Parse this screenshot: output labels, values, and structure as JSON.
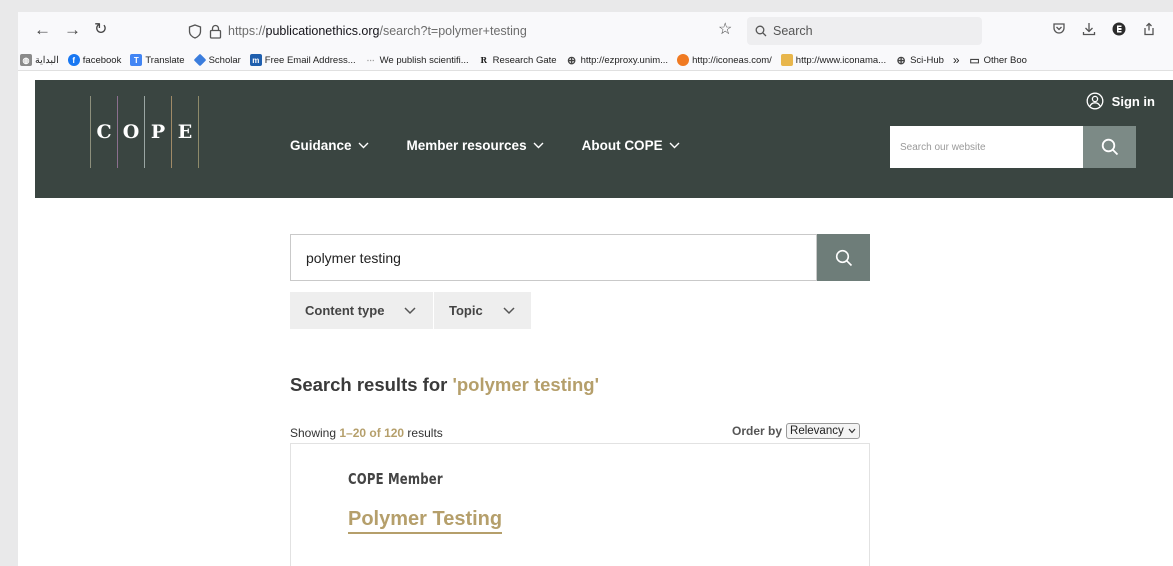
{
  "browser": {
    "url_prefix": "https://",
    "url_domain": "publicationethics.org",
    "url_path": "/search?t=polymer+testing",
    "search_placeholder": "Search",
    "bookmarks": [
      {
        "label": "البداية",
        "icon": "globe-icon"
      },
      {
        "label": "facebook",
        "icon": "facebook-icon"
      },
      {
        "label": "Translate",
        "icon": "translate-icon"
      },
      {
        "label": "Scholar",
        "icon": "scholar-icon"
      },
      {
        "label": "Free Email Address...",
        "icon": "mail-icon"
      },
      {
        "label": "We publish scientifi...",
        "icon": "link-icon"
      },
      {
        "label": "Research Gate",
        "icon": "researchgate-icon"
      },
      {
        "label": "http://ezproxy.unim...",
        "icon": "globe-icon"
      },
      {
        "label": "http://iconeas.com/",
        "icon": "iconeas-icon"
      },
      {
        "label": "http://www.iconama...",
        "icon": "iconama-icon"
      },
      {
        "label": "Sci-Hub",
        "icon": "globe-icon"
      }
    ],
    "bookmarks_more": "»",
    "other_bookmarks": "Other Boo"
  },
  "site": {
    "logo_letters": [
      "C",
      "O",
      "P",
      "E"
    ],
    "nav": [
      "Guidance",
      "Member resources",
      "About COPE"
    ],
    "signin_label": "Sign in",
    "search_placeholder": "Search our website"
  },
  "search": {
    "query": "polymer testing",
    "filters": [
      "Content type",
      "Topic"
    ]
  },
  "results": {
    "title_prefix": "Search results for ",
    "title_query": "'polymer testing'",
    "showing_prefix": "Showing ",
    "showing_range": "1–20 of 120",
    "showing_suffix": " results",
    "order_label": "Order by",
    "order_value": "Relevancy",
    "items": [
      {
        "kicker": "COPE Member",
        "title": "Polymer Testing"
      }
    ]
  },
  "colors": {
    "header_bg": "#3a4541",
    "accent_gold": "#b59f6b",
    "search_button": "#6e7d79"
  }
}
